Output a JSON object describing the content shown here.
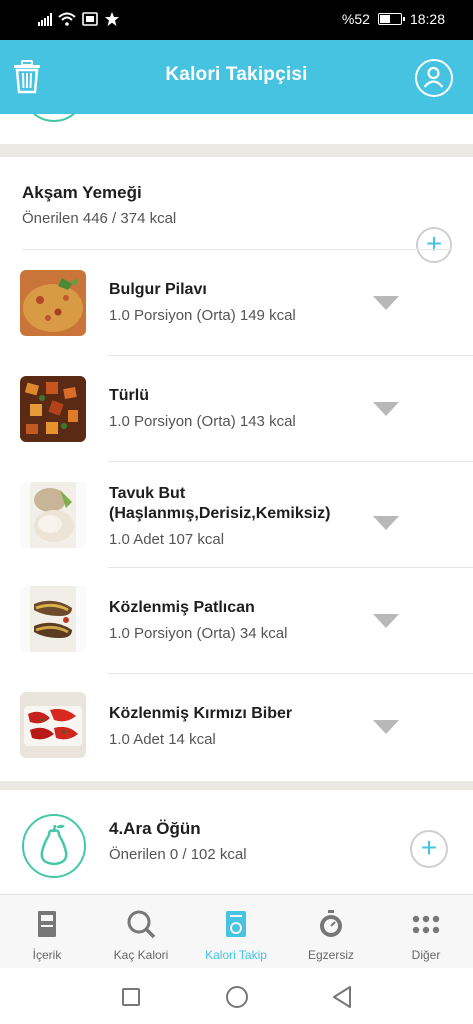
{
  "status_bar": {
    "battery": "%52",
    "time": "18:28",
    "battery_level": 0.52
  },
  "header": {
    "title": "Kalori Takipçisi"
  },
  "dinner": {
    "title": "Akşam Yemeği",
    "summary": "Önerilen 446 / 374 kcal",
    "items": [
      {
        "name": "Bulgur Pilavı",
        "detail": "1.0 Porsiyon (Orta) 149 kcal"
      },
      {
        "name": "Türlü",
        "detail": "1.0 Porsiyon (Orta) 143 kcal"
      },
      {
        "name": "Tavuk But (Haşlanmış,Derisiz,Kemiksiz)",
        "detail": "1.0 Adet 107 kcal"
      },
      {
        "name": "Közlenmiş Patlıcan",
        "detail": "1.0 Porsiyon (Orta) 34 kcal"
      },
      {
        "name": "Közlenmiş Kırmızı Biber",
        "detail": "1.0 Adet 14 kcal"
      }
    ]
  },
  "snack": {
    "title": "4.Ara Öğün",
    "summary": "Önerilen 0 / 102 kcal"
  },
  "add_symbol": "+",
  "bottom_nav": [
    {
      "label": "İçerik",
      "icon": "book-icon"
    },
    {
      "label": "Kaç Kalori",
      "icon": "search-icon"
    },
    {
      "label": "Kalori Takip",
      "icon": "tracker-icon",
      "active": true
    },
    {
      "label": "Egzersiz",
      "icon": "stopwatch-icon"
    },
    {
      "label": "Diğer",
      "icon": "more-icon"
    }
  ],
  "colors": {
    "brand": "#45c3e0",
    "accent_green": "#45c8a7"
  }
}
